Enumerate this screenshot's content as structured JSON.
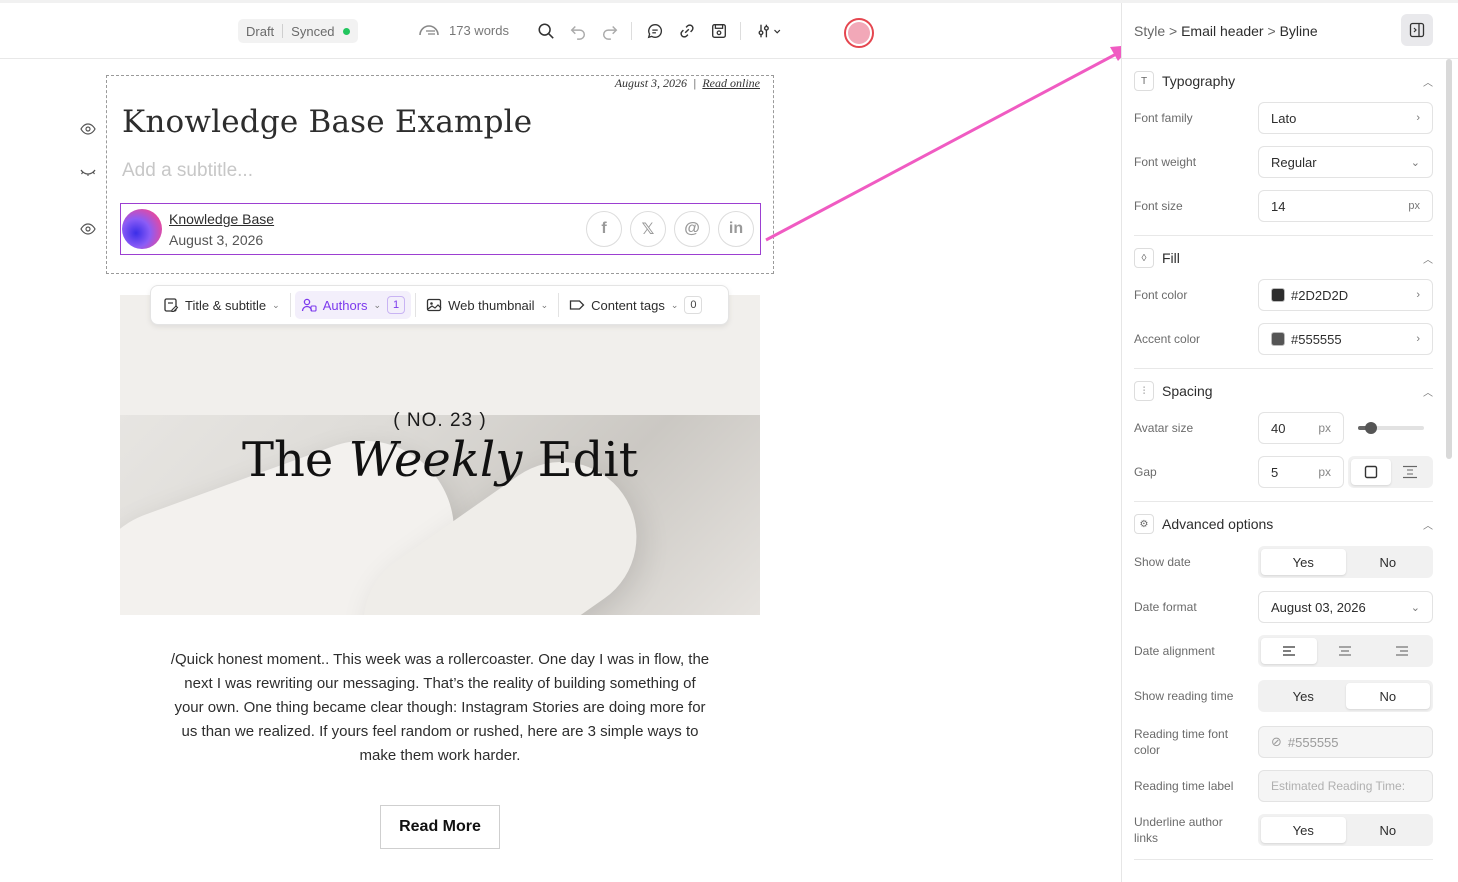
{
  "toolbar": {
    "status_draft": "Draft",
    "status_synced": "Synced",
    "word_count": "173 words",
    "icons": [
      "search-icon",
      "undo-icon",
      "redo-icon",
      "comment-icon",
      "link-icon",
      "save-icon",
      "settings-sliders-icon"
    ]
  },
  "editor": {
    "meta_date": "August 3, 2026",
    "meta_separator": "|",
    "read_online": "Read online",
    "title": "Knowledge Base Example",
    "subtitle_placeholder": "Add a subtitle...",
    "byline": {
      "author": "Knowledge Base",
      "date": "August 3, 2026"
    },
    "socials": [
      "f",
      "𝕏",
      "@",
      "in"
    ],
    "block_bar": {
      "title_subtitle": "Title & subtitle",
      "authors": "Authors",
      "authors_count": "1",
      "web_thumbnail": "Web thumbnail",
      "content_tags": "Content tags",
      "content_tags_count": "0"
    },
    "hero": {
      "number": "( NO. 23 )",
      "headline_pre": "The ",
      "headline_italic": "Weekly",
      "headline_post": " Edit"
    },
    "body": "/Quick honest moment.. This week was a rollercoaster. One day I was in flow, the next I was rewriting our messaging. That’s the reality of building something of your own. One thing became clear though: Instagram Stories are doing more for us than we realized. If yours feel random or rushed, here are 3 simple ways to make them work harder.",
    "read_more": "Read More"
  },
  "panel": {
    "breadcrumb": {
      "part1": "Style",
      "sep": ">",
      "part2": "Email header",
      "part3": "Byline"
    },
    "typography": {
      "title": "Typography",
      "font_family_label": "Font family",
      "font_family": "Lato",
      "font_weight_label": "Font weight",
      "font_weight": "Regular",
      "font_size_label": "Font size",
      "font_size": "14",
      "font_size_unit": "px"
    },
    "fill": {
      "title": "Fill",
      "font_color_label": "Font color",
      "font_color": "#2D2D2D",
      "accent_color_label": "Accent color",
      "accent_color": "#555555"
    },
    "spacing": {
      "title": "Spacing",
      "avatar_size_label": "Avatar size",
      "avatar_size": "40",
      "avatar_unit": "px",
      "avatar_slider_fraction": 0.2,
      "gap_label": "Gap",
      "gap": "5",
      "gap_unit": "px"
    },
    "advanced": {
      "title": "Advanced options",
      "show_date_label": "Show date",
      "yes": "Yes",
      "no": "No",
      "date_format_label": "Date format",
      "date_format": "August 03, 2026",
      "date_alignment_label": "Date alignment",
      "show_reading_time_label": "Show reading time",
      "reading_time_color_label": "Reading time font color",
      "reading_time_color": "#555555",
      "reading_time_label_label": "Reading time label",
      "reading_time_label_placeholder": "Estimated Reading Time:",
      "underline_label": "Underline author links"
    }
  }
}
